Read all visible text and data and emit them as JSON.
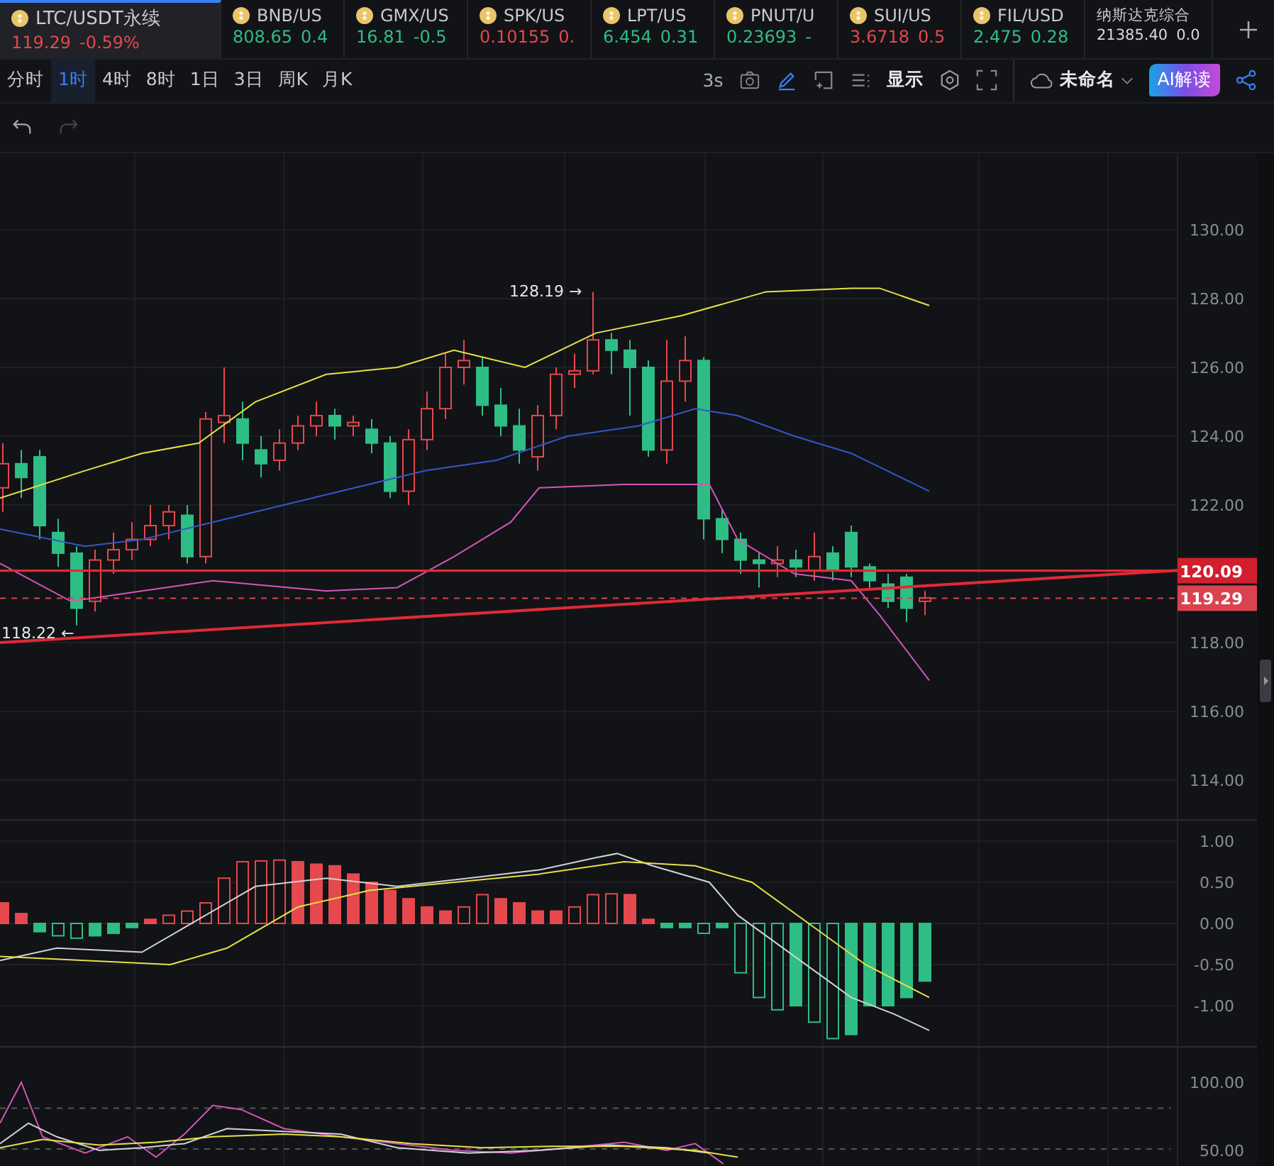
{
  "tickers": [
    {
      "symbol": "LTC/USDT永续",
      "price": "119.29",
      "change": "-0.59%",
      "color": "#e5484d",
      "icon": true,
      "selected": true
    },
    {
      "symbol": "BNB/US",
      "price": "808.65",
      "change": "0.4",
      "color": "#2ebd85",
      "icon": true,
      "selected": false
    },
    {
      "symbol": "GMX/US",
      "price": "16.81",
      "change": "-0.5",
      "color": "#2ebd85",
      "icon": true,
      "selected": false
    },
    {
      "symbol": "SPK/US",
      "price": "0.10155",
      "change": "0.",
      "color": "#e5484d",
      "icon": true,
      "selected": false
    },
    {
      "symbol": "LPT/US",
      "price": "6.454",
      "change": "0.31",
      "color": "#2ebd85",
      "icon": true,
      "selected": false
    },
    {
      "symbol": "PNUT/U",
      "price": "0.23693",
      "change": "-",
      "color": "#2ebd85",
      "icon": true,
      "selected": false
    },
    {
      "symbol": "SUI/US",
      "price": "3.6718",
      "change": "0.5",
      "color": "#e5484d",
      "icon": true,
      "selected": false
    },
    {
      "symbol": "FIL/USD",
      "price": "2.475",
      "change": "0.28",
      "color": "#2ebd85",
      "icon": true,
      "selected": false
    },
    {
      "symbol": "纳斯达克综合",
      "price": "21385.40",
      "change": "0.0",
      "color": "#d8d9dc",
      "icon": false,
      "selected": false
    }
  ],
  "intervals": [
    {
      "label": "分时",
      "selected": false
    },
    {
      "label": "1时",
      "selected": true
    },
    {
      "label": "4时",
      "selected": false
    },
    {
      "label": "8时",
      "selected": false
    },
    {
      "label": "1日",
      "selected": false
    },
    {
      "label": "3日",
      "selected": false
    },
    {
      "label": "周K",
      "selected": false
    },
    {
      "label": "月K",
      "selected": false
    }
  ],
  "toolbar": {
    "refresh": "3s",
    "display": "显示",
    "layout": "未命名",
    "ai": "AI解读"
  },
  "chart": {
    "high_marker": "128.19 →",
    "low_marker": "118.22 ←",
    "price_axis": [
      "130.00",
      "128.00",
      "126.00",
      "124.00",
      "122.00",
      "118.00",
      "116.00",
      "114.00"
    ],
    "price_tags": [
      {
        "text": "120.09",
        "kind": "line"
      },
      {
        "text": "119.29",
        "kind": "last"
      }
    ],
    "macd_axis": [
      "1.00",
      "0.50",
      "0.00",
      "-0.50",
      "-1.00"
    ],
    "osc_axis": [
      "100.00",
      "50.00"
    ]
  }
}
